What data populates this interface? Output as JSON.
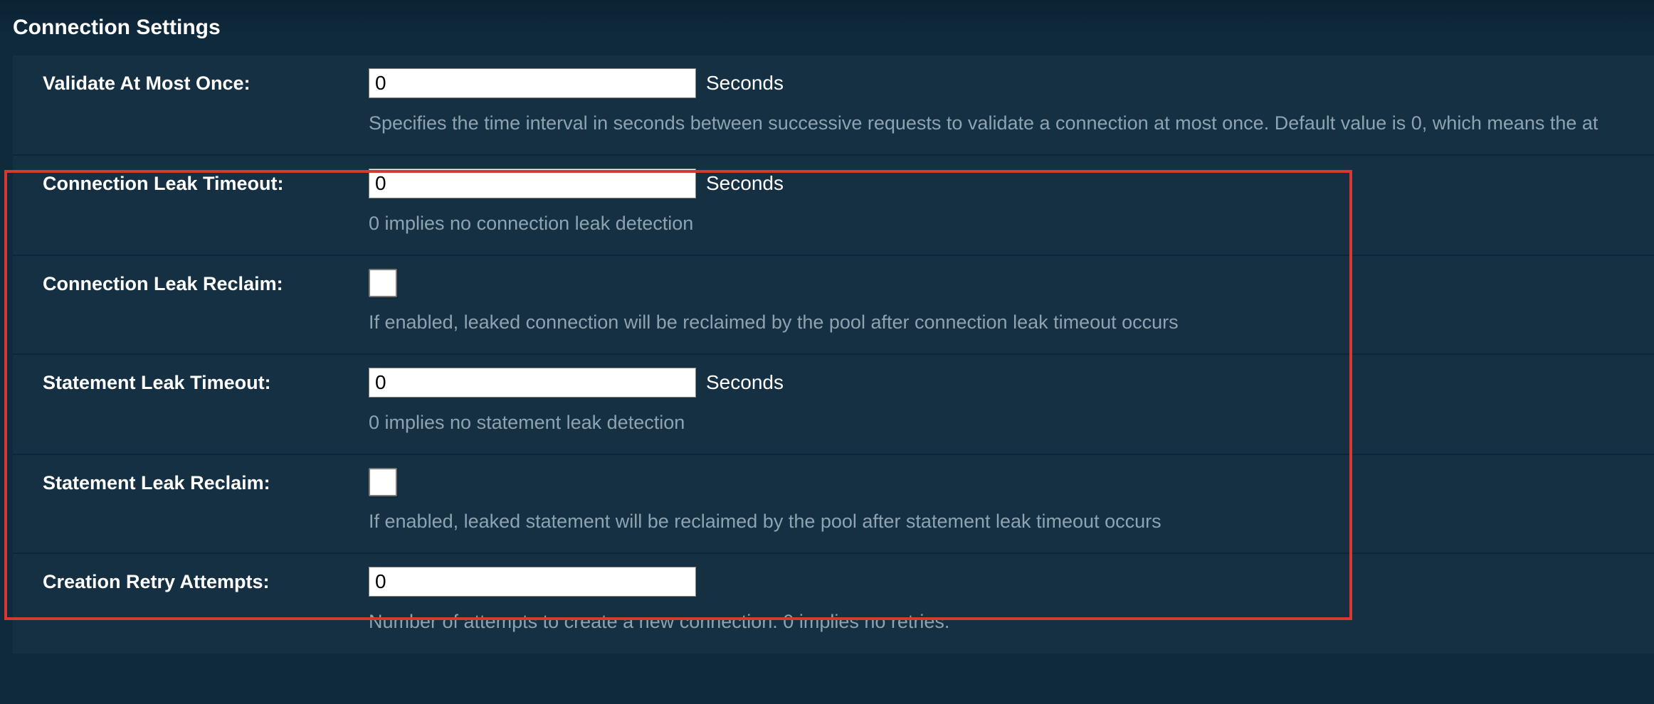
{
  "section_title": "Connection Settings",
  "units": {
    "seconds": "Seconds"
  },
  "fields": {
    "validate_at_most_once": {
      "label": "Validate At Most Once:",
      "value": "0",
      "unit": "Seconds",
      "desc": "Specifies the time interval in seconds between successive requests to validate a connection at most once. Default value is 0, which means the at"
    },
    "connection_leak_timeout": {
      "label": "Connection Leak Timeout:",
      "value": "0",
      "unit": "Seconds",
      "desc": "0 implies no connection leak detection"
    },
    "connection_leak_reclaim": {
      "label": "Connection Leak Reclaim:",
      "checked": false,
      "desc": "If enabled, leaked connection will be reclaimed by the pool after connection leak timeout occurs"
    },
    "statement_leak_timeout": {
      "label": "Statement Leak Timeout:",
      "value": "0",
      "unit": "Seconds",
      "desc": "0 implies no statement leak detection"
    },
    "statement_leak_reclaim": {
      "label": "Statement Leak Reclaim:",
      "checked": false,
      "desc": "If enabled, leaked statement will be reclaimed by the pool after statement leak timeout occurs"
    },
    "creation_retry_attempts": {
      "label": "Creation Retry Attempts:",
      "value": "0",
      "desc": "Number of attempts to create a new connection. 0 implies no retries."
    }
  }
}
